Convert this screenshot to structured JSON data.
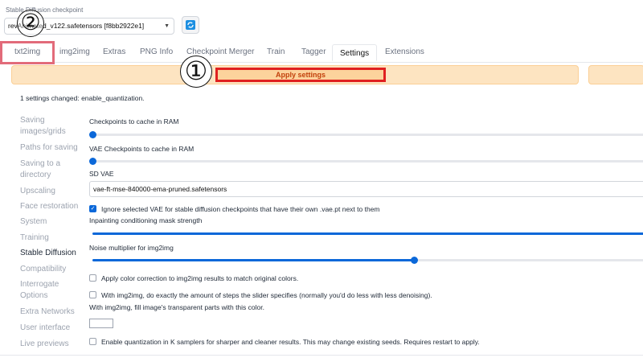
{
  "checkpoint": {
    "label": "Stable Diffusion checkpoint",
    "value": "revAnimated_v122.safetensors [f8bb2922e1]"
  },
  "tabs": [
    "txt2img",
    "img2img",
    "Extras",
    "PNG Info",
    "Checkpoint Merger",
    "Train",
    "Tagger",
    "Settings",
    "Extensions"
  ],
  "active_tab": "Settings",
  "apply_button": "Apply settings",
  "changed_text": "1 settings changed: enable_quantization.",
  "sidebar": [
    "Saving images/grids",
    "Paths for saving",
    "Saving to a directory",
    "Upscaling",
    "Face restoration",
    "System",
    "Training",
    "Stable Diffusion",
    "Compatibility",
    "Interrogate Options",
    "Extra Networks",
    "User interface",
    "Live previews"
  ],
  "active_sidebar": "Stable Diffusion",
  "settings": {
    "ckpt_cache_label": "Checkpoints to cache in RAM",
    "ckpt_cache_value": 0,
    "vae_cache_label": "VAE Checkpoints to cache in RAM",
    "vae_cache_value": 0,
    "sd_vae_label": "SD VAE",
    "sd_vae_value": "vae-ft-mse-840000-ema-pruned.safetensors",
    "ignore_vae_label": "Ignore selected VAE for stable diffusion checkpoints that have their own .vae.pt next to them",
    "ignore_vae_checked": true,
    "inpaint_label": "Inpainting conditioning mask strength",
    "inpaint_fraction": 1.0,
    "noise_label": "Noise multiplier for img2img",
    "noise_fraction": 0.58,
    "color_correction_label": "Apply color correction to img2img results to match original colors.",
    "exact_steps_label": "With img2img, do exactly the amount of steps the slider specifies (normally you'd do less with less denoising).",
    "fill_transparent_label": "With img2img, fill image's transparent parts with this color.",
    "fill_color": "#ffffff",
    "quantization_label": "Enable quantization in K samplers for sharper and cleaner results. This may change existing seeds. Requires restart to apply."
  },
  "annotations": {
    "marker_1": "①",
    "marker_2": "②"
  },
  "colors": {
    "accent": "#0b68d9",
    "apply_bg": "#fcd39c",
    "highlight": "#e02020"
  }
}
